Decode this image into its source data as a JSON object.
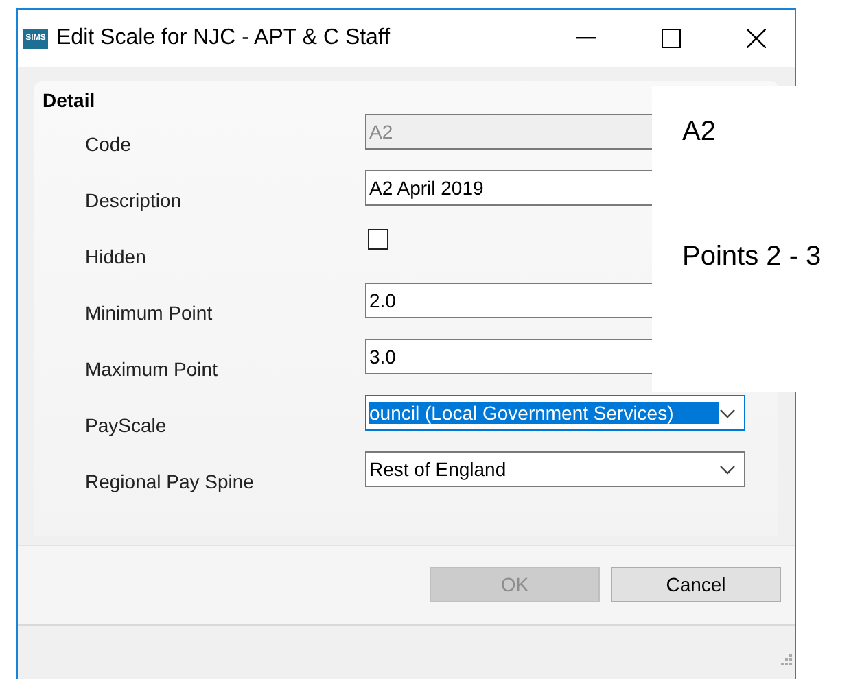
{
  "window": {
    "title": "Edit Scale for NJC - APT & C Staff",
    "app_badge": "SIMS"
  },
  "section": {
    "title": "Detail"
  },
  "fields": [
    {
      "kind": "text",
      "label": "Code",
      "value": "A2",
      "disabled": true
    },
    {
      "kind": "text",
      "label": "Description",
      "value": "A2 April 2019",
      "disabled": false
    },
    {
      "kind": "checkbox",
      "label": "Hidden",
      "checked": false
    },
    {
      "kind": "text",
      "label": "Minimum Point",
      "value": "2.0",
      "disabled": false
    },
    {
      "kind": "text",
      "label": "Maximum Point",
      "value": "3.0",
      "disabled": false
    },
    {
      "kind": "select",
      "label": "PayScale",
      "value": "ouncil (Local Government Services)",
      "selected": true
    },
    {
      "kind": "select",
      "label": "Regional Pay Spine",
      "value": "Rest of England",
      "selected": false
    }
  ],
  "buttons": [
    {
      "label": "OK",
      "disabled": true
    },
    {
      "label": "Cancel",
      "disabled": false
    }
  ],
  "note": {
    "lines": [
      "A2",
      "Points 2 - 3"
    ]
  }
}
